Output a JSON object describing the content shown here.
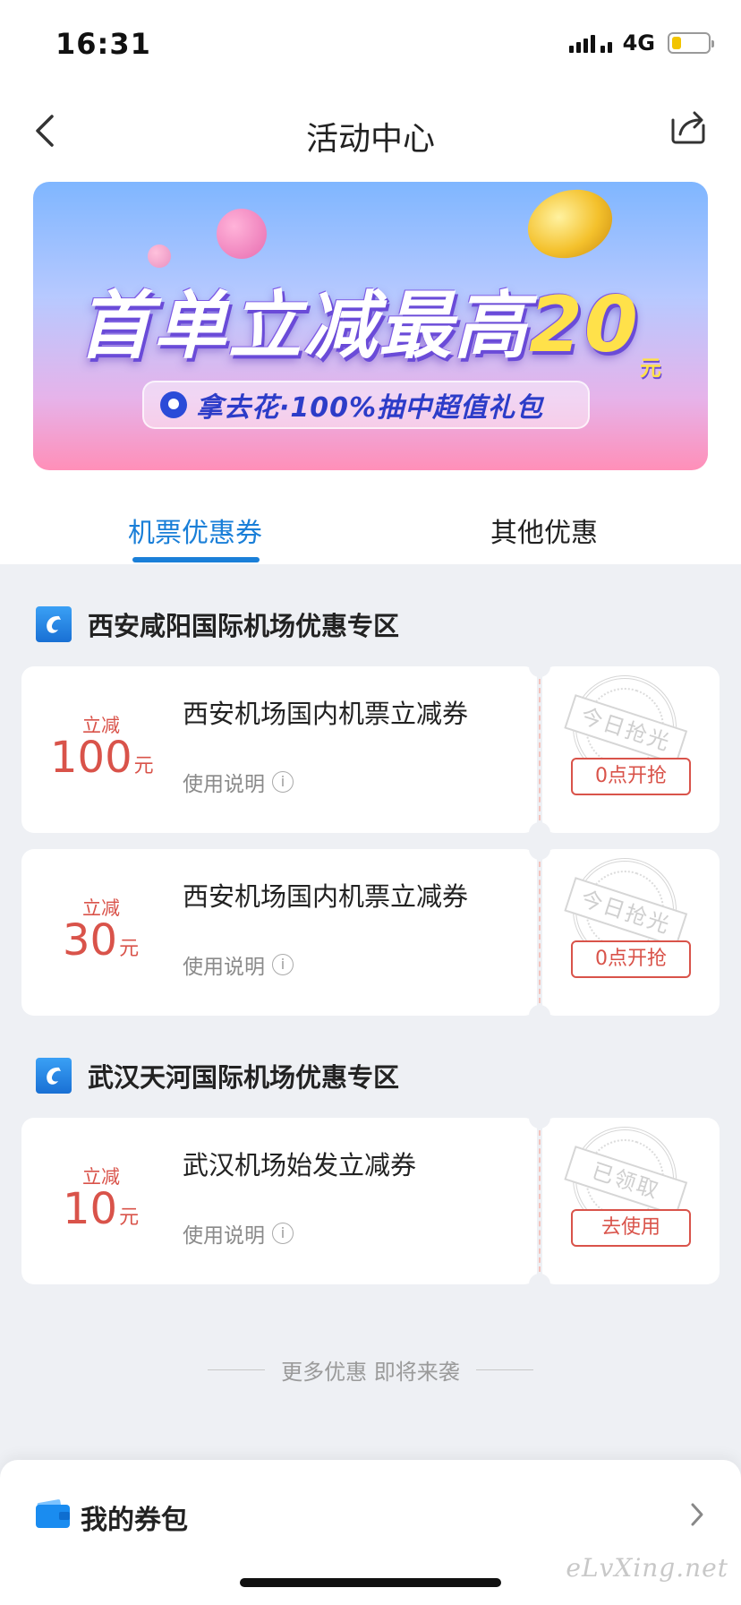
{
  "status_bar": {
    "time": "16:31",
    "network": "4G",
    "battery_level": 0.25
  },
  "nav": {
    "title": "活动中心"
  },
  "banner": {
    "headline_main": "首单立减最高",
    "headline_amount": "20",
    "headline_unit": "元",
    "subline": "拿去花·100%抽中超值礼包"
  },
  "tabs": [
    {
      "label": "机票优惠券",
      "active": true
    },
    {
      "label": "其他优惠",
      "active": false
    }
  ],
  "sections": [
    {
      "title": "西安咸阳国际机场优惠专区",
      "coupons": [
        {
          "prefix": "立减",
          "amount": "100",
          "unit": "元",
          "name": "西安机场国内机票立减券",
          "help": "使用说明",
          "stamp": "今日抢光",
          "button": "0点开抢"
        },
        {
          "prefix": "立减",
          "amount": "30",
          "unit": "元",
          "name": "西安机场国内机票立减券",
          "help": "使用说明",
          "stamp": "今日抢光",
          "button": "0点开抢"
        }
      ]
    },
    {
      "title": "武汉天河国际机场优惠专区",
      "coupons": [
        {
          "prefix": "立减",
          "amount": "10",
          "unit": "元",
          "name": "武汉机场始发立减券",
          "help": "使用说明",
          "stamp": "已领取",
          "button": "去使用"
        }
      ]
    }
  ],
  "more_deals": "更多优惠 即将来袭",
  "wallet": {
    "title": "我的券包"
  },
  "watermark": "eLvXing.net",
  "colors": {
    "accent_blue": "#1a7fd8",
    "coupon_red": "#d9534a",
    "background": "#eef0f4"
  }
}
